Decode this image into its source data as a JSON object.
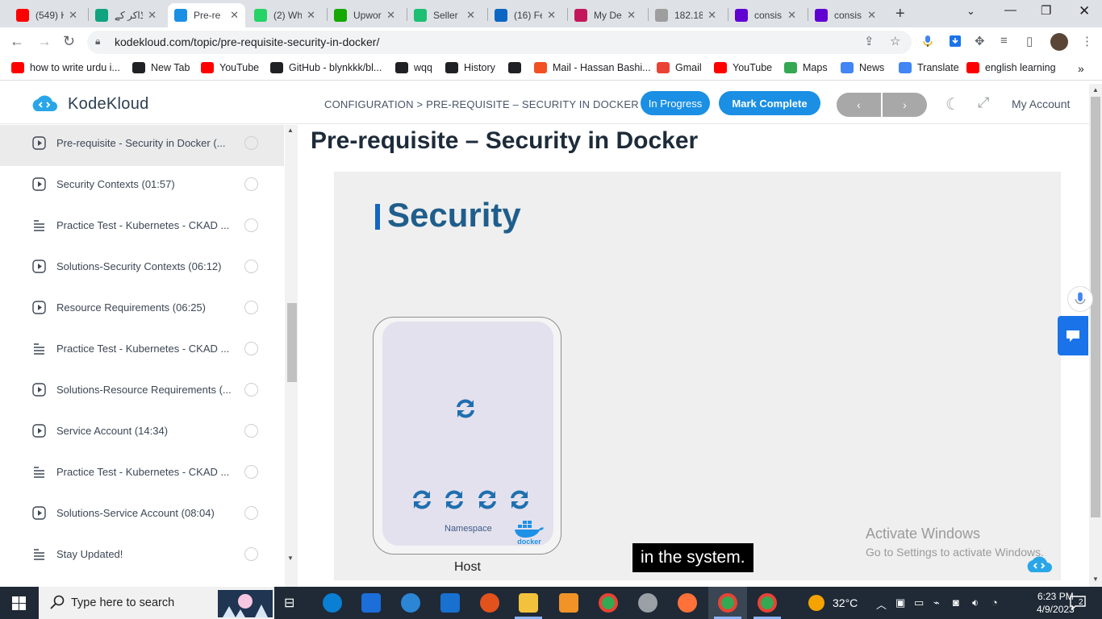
{
  "browser": {
    "tabs": [
      {
        "title": "(549) H",
        "icon": "youtube-icon",
        "color": "#ff0000"
      },
      {
        "title": "ڈاکر کے",
        "icon": "chatgpt-icon",
        "color": "#10a37f"
      },
      {
        "title": "Pre-re",
        "icon": "kodekloud-icon",
        "color": "#1a8fe3",
        "active": true
      },
      {
        "title": "(2) Wh",
        "icon": "whatsapp-icon",
        "color": "#25d366"
      },
      {
        "title": "Upwor",
        "icon": "upwork-icon",
        "color": "#14a800"
      },
      {
        "title": "Seller",
        "icon": "fiverr-icon",
        "color": "#1dbf73"
      },
      {
        "title": "(16) Fe",
        "icon": "linkedin-icon",
        "color": "#0a66c2"
      },
      {
        "title": "My De",
        "icon": "site-icon",
        "color": "#c2185b"
      },
      {
        "title": "182.18",
        "icon": "globe-icon",
        "color": "#9e9e9e"
      },
      {
        "title": "consis",
        "icon": "yahoo-icon",
        "color": "#6001d2"
      },
      {
        "title": "consis",
        "icon": "yahoo-icon",
        "color": "#6001d2"
      }
    ],
    "url": "kodekloud.com/topic/pre-requisite-security-in-docker/",
    "bookmarks": [
      {
        "label": "how to write urdu i...",
        "icon": "youtube-icon",
        "color": "#ff0000"
      },
      {
        "label": "New Tab",
        "icon": "chrome-icon",
        "color": "#202124"
      },
      {
        "label": "YouTube",
        "icon": "youtube-icon",
        "color": "#ff0000"
      },
      {
        "label": "GitHub - blynkkk/bl...",
        "icon": "github-icon",
        "color": "#202124"
      },
      {
        "label": "wqq",
        "icon": "download-icon",
        "color": "#202124"
      },
      {
        "label": "History",
        "icon": "history-icon",
        "color": "#202124"
      },
      {
        "label": "",
        "icon": "globe-icon",
        "color": "#202124"
      },
      {
        "label": "Mail - Hassan Bashi...",
        "icon": "microsoft-icon",
        "color": "#f25022"
      },
      {
        "label": "Gmail",
        "icon": "gmail-icon",
        "color": "#ea4335"
      },
      {
        "label": "YouTube",
        "icon": "youtube-icon",
        "color": "#ff0000"
      },
      {
        "label": "Maps",
        "icon": "maps-icon",
        "color": "#34a853"
      },
      {
        "label": "News",
        "icon": "news-icon",
        "color": "#4285f4"
      },
      {
        "label": "Translate",
        "icon": "translate-icon",
        "color": "#4285f4"
      },
      {
        "label": "english learning",
        "icon": "youtube-icon",
        "color": "#ff0000"
      }
    ]
  },
  "site": {
    "logo": "KodeKloud",
    "breadcrumb": "CONFIGURATION > PRE-REQUISITE – SECURITY IN DOCKER",
    "status": "In Progress",
    "mark_complete": "Mark Complete",
    "prev": "‹",
    "next": "›",
    "account": "My Account",
    "accent": "#1a8fe3"
  },
  "sidebar": {
    "items": [
      {
        "label": "Pre-requisite - Security in Docker (...",
        "type": "video",
        "active": true
      },
      {
        "label": "Security Contexts (01:57)",
        "type": "video"
      },
      {
        "label": "Practice Test - Kubernetes - CKAD ...",
        "type": "lab"
      },
      {
        "label": "Solutions-Security Contexts (06:12)",
        "type": "video"
      },
      {
        "label": "Resource Requirements (06:25)",
        "type": "video"
      },
      {
        "label": "Practice Test - Kubernetes - CKAD ...",
        "type": "lab"
      },
      {
        "label": "Solutions-Resource Requirements (...",
        "type": "video"
      },
      {
        "label": "Service Account (14:34)",
        "type": "video"
      },
      {
        "label": "Practice Test - Kubernetes - CKAD ...",
        "type": "lab"
      },
      {
        "label": "Solutions-Service Account (08:04)",
        "type": "video"
      },
      {
        "label": "Stay Updated!",
        "type": "lab"
      }
    ]
  },
  "main": {
    "title": "Pre-requisite – Security in Docker",
    "video": {
      "slide_title": "Security",
      "namespace_label": "Namespace",
      "host_label": "Host",
      "docker_label": "docker",
      "caption": "in the system."
    },
    "watermark": {
      "line1": "Activate Windows",
      "line2": "Go to Settings to activate Windows."
    }
  },
  "taskbar": {
    "search_placeholder": "Type here to search",
    "weather": "32°C",
    "time": "6:23 PM",
    "date": "4/9/2023",
    "notifications": "2"
  }
}
